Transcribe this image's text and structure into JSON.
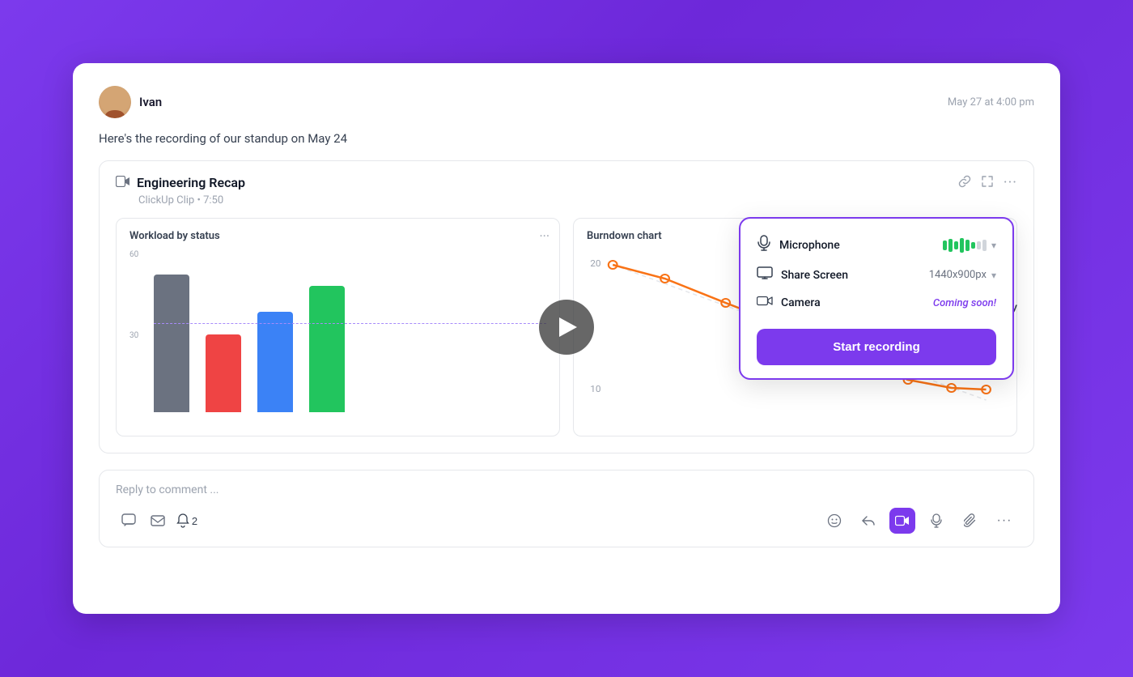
{
  "background": {
    "gradient_start": "#7c3aed",
    "gradient_end": "#6d28d9"
  },
  "post": {
    "author": "Ivan",
    "timestamp": "May 27 at 4:00 pm",
    "message": "Here's the recording of our standup on May 24"
  },
  "clip": {
    "title": "Engineering Recap",
    "source": "ClickUp Clip",
    "duration": "7:50",
    "meta_separator": "•"
  },
  "workload_chart": {
    "title": "Workload by status",
    "y_labels": [
      "60",
      "30"
    ],
    "bars": [
      {
        "color": "#6b7280",
        "height_pct": 85
      },
      {
        "color": "#ef4444",
        "height_pct": 48
      },
      {
        "color": "#3b82f6",
        "height_pct": 62
      },
      {
        "color": "#22c55e",
        "height_pct": 78
      }
    ]
  },
  "burndown_chart": {
    "title": "Burndown chart",
    "y_labels": [
      "20",
      "10"
    ]
  },
  "recording_popup": {
    "microphone_label": "Microphone",
    "share_screen_label": "Share Screen",
    "share_screen_resolution": "1440x900px",
    "camera_label": "Camera",
    "camera_coming_soon": "Coming soon!",
    "start_button_label": "Start recording"
  },
  "comment": {
    "placeholder": "Reply to comment ...",
    "notification_label": "2"
  },
  "toolbar": {
    "icons": [
      "💬",
      "✉",
      "🔔",
      "😊",
      "↩",
      "📹",
      "🎤",
      "📎",
      "•••"
    ]
  },
  "icons": {
    "clip": "🎬",
    "link": "🔗",
    "expand": "⛶",
    "more": "•••",
    "microphone": "🎤",
    "screen": "🖥",
    "camera": "📷",
    "chat": "💬",
    "email": "✉",
    "bell": "🔔",
    "emoji": "🙂",
    "reply_arrow": "↩",
    "video_camera": "📹",
    "mic_toolbar": "🎤",
    "attachment": "📎"
  }
}
